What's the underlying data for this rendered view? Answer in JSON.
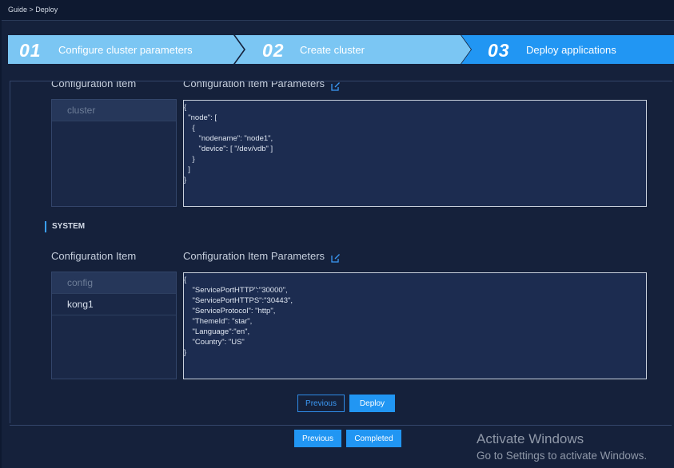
{
  "breadcrumb": "Guide > Deploy",
  "steps": [
    {
      "num": "01",
      "label": "Configure cluster parameters"
    },
    {
      "num": "02",
      "label": "Create cluster"
    },
    {
      "num": "03",
      "label": "Deploy applications"
    }
  ],
  "colors": {
    "step_light": "#7bc6f3",
    "step_active": "#2196f3",
    "accent": "#2196f3"
  },
  "cluster_section": {
    "item_header": "Configuration Item",
    "params_header": "Configuration Item Parameters",
    "items": [
      "cluster"
    ],
    "code": [
      "{",
      "  \"node\": [",
      "    {",
      "       \"nodename\": \"node1\",",
      "       \"device\": [ \"/dev/vdb\" ]",
      "    }",
      "  ]",
      "}"
    ]
  },
  "system_section": {
    "label": "SYSTEM",
    "item_header": "Configuration Item",
    "params_header": "Configuration Item Parameters",
    "items": [
      "config",
      "kong1"
    ],
    "code": [
      "{",
      "    \"ServicePortHTTP\":\"30000\",",
      "    \"ServicePortHTTPS\":\"30443\",",
      "    \"ServiceProtocol\": \"http\",",
      "    \"ThemeId\": \"star\",",
      "    \"Language\":\"en\",",
      "    \"Country\": \"US\"",
      "}"
    ]
  },
  "panel_buttons": {
    "previous": "Previous",
    "deploy": "Deploy"
  },
  "footer_buttons": {
    "previous": "Previous",
    "completed": "Completed"
  },
  "watermark": {
    "line1": "Activate Windows",
    "line2": "Go to Settings to activate Windows."
  },
  "icons": {
    "edit": "edit-icon"
  }
}
